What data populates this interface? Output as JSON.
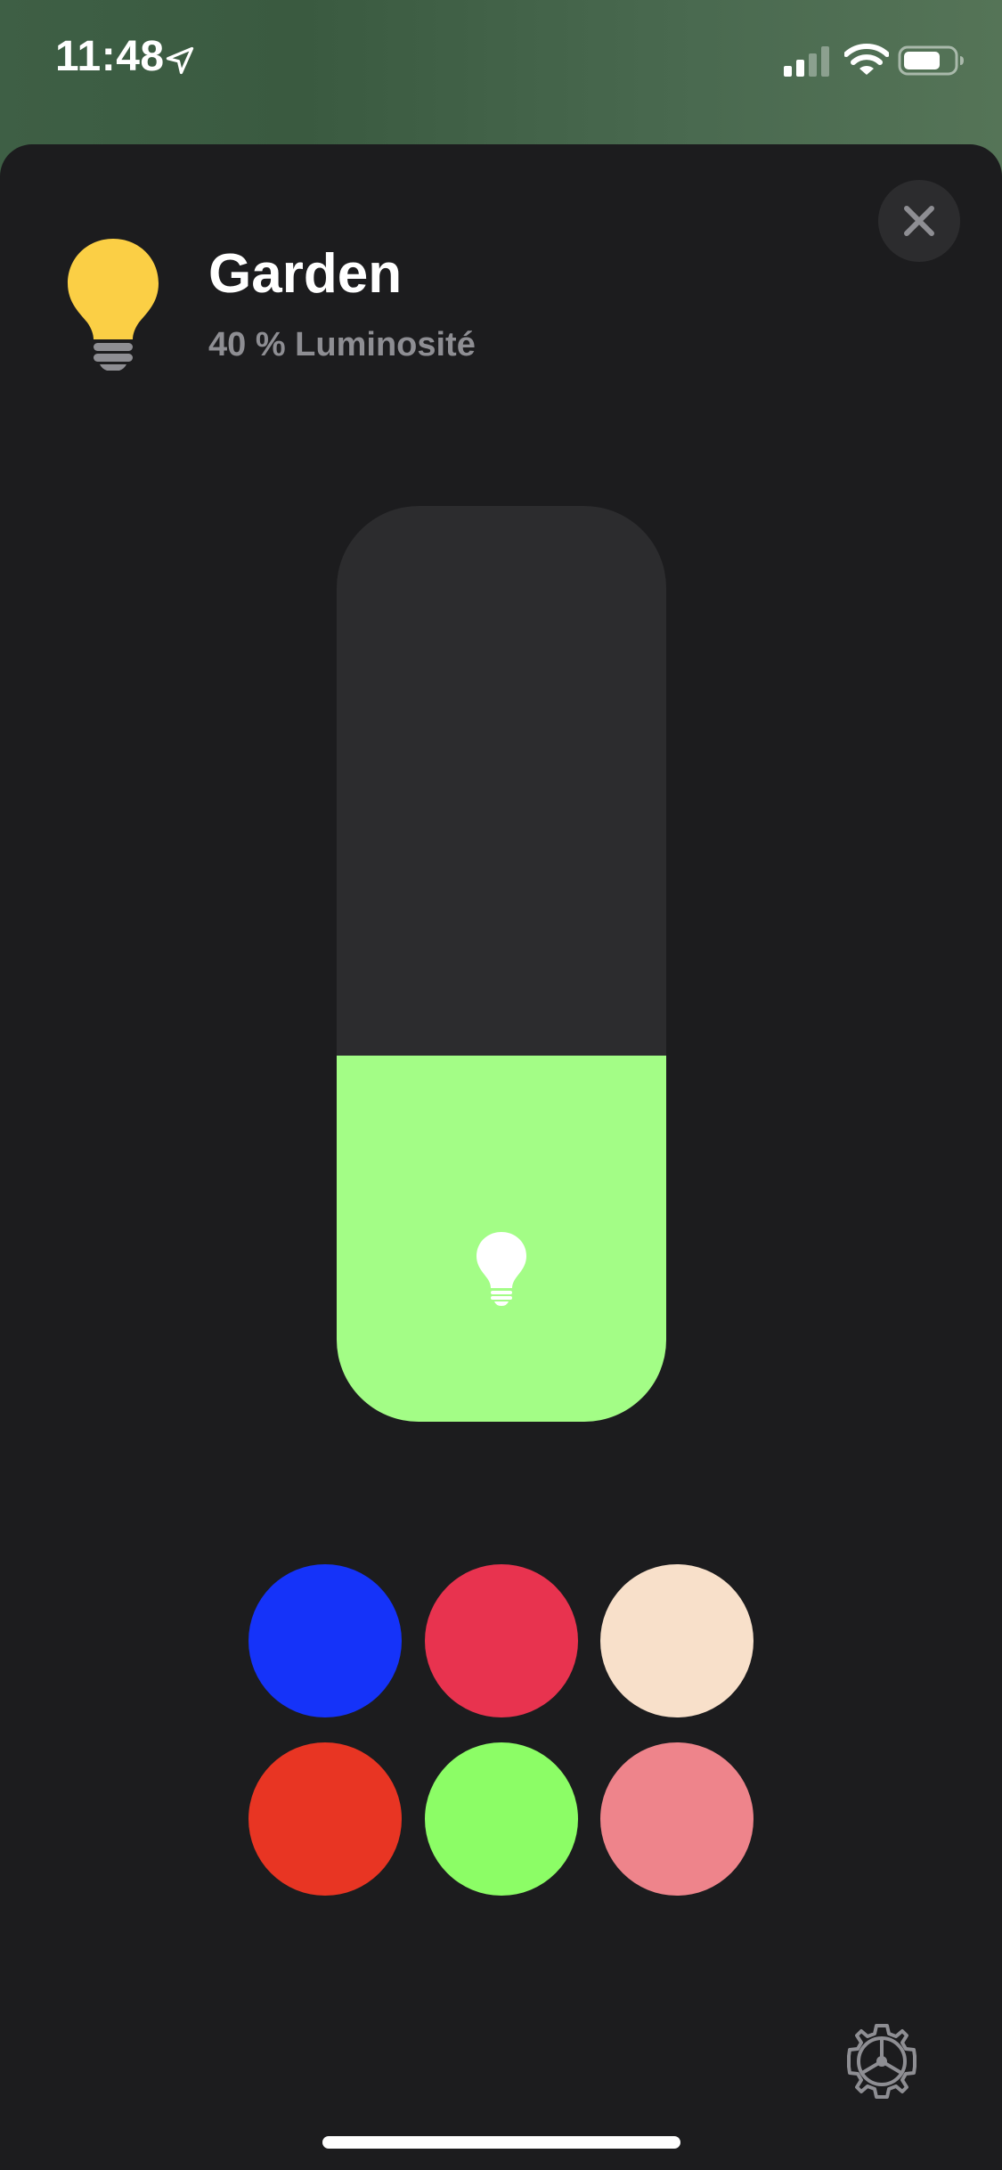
{
  "status_bar": {
    "time": "11:48",
    "icons": [
      "location-arrow-icon",
      "cellular-signal-icon",
      "wifi-icon",
      "battery-icon"
    ]
  },
  "accessory": {
    "name": "Garden",
    "status": "40 % Luminosité",
    "icon": "lightbulb-icon",
    "icon_color": "#FBCF45"
  },
  "brightness": {
    "level_percent": 40,
    "fill_color": "#A3FD86",
    "track_color": "#2C2C2E",
    "icon": "lightbulb-icon"
  },
  "color_presets": [
    {
      "color": "#1533F9"
    },
    {
      "color": "#E8334F"
    },
    {
      "color": "#F8E0CA"
    },
    {
      "color": "#E83523"
    },
    {
      "color": "#8CFD66"
    },
    {
      "color": "#EE848B"
    }
  ],
  "controls": {
    "close_icon": "close-icon",
    "settings_icon": "gear-icon"
  }
}
